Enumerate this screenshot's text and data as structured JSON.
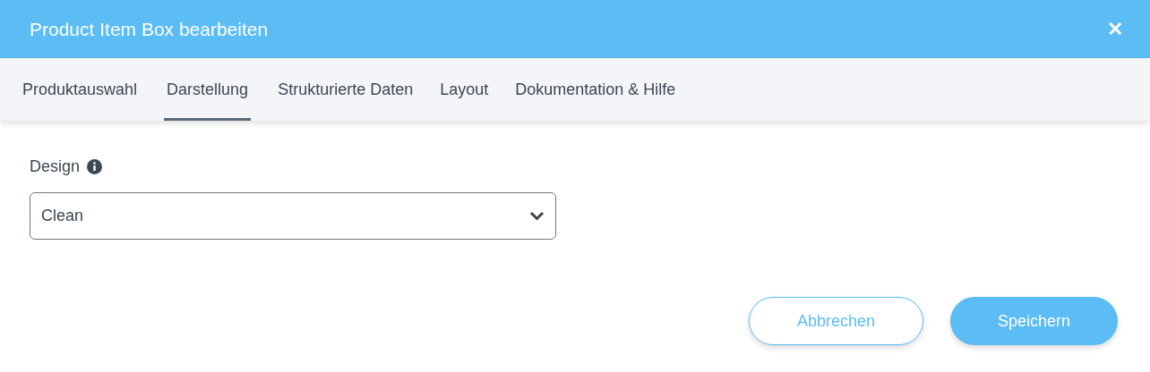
{
  "window": {
    "title": "Product Item Box bearbeiten",
    "close": "✕"
  },
  "tabs": [
    {
      "label": "Produktauswahl",
      "selected": false
    },
    {
      "label": "Darstellung",
      "selected": true
    },
    {
      "label": "Strukturierte Daten",
      "selected": false
    },
    {
      "label": "Layout",
      "selected": false
    },
    {
      "label": "Dokumentation & Hilfe",
      "selected": false
    }
  ],
  "design": {
    "label": "Design",
    "value": "Clean"
  },
  "buttons": [
    {
      "label": "Abbrechen",
      "kind": "secondary"
    },
    {
      "label": "Speichern",
      "kind": "primary"
    }
  ]
}
